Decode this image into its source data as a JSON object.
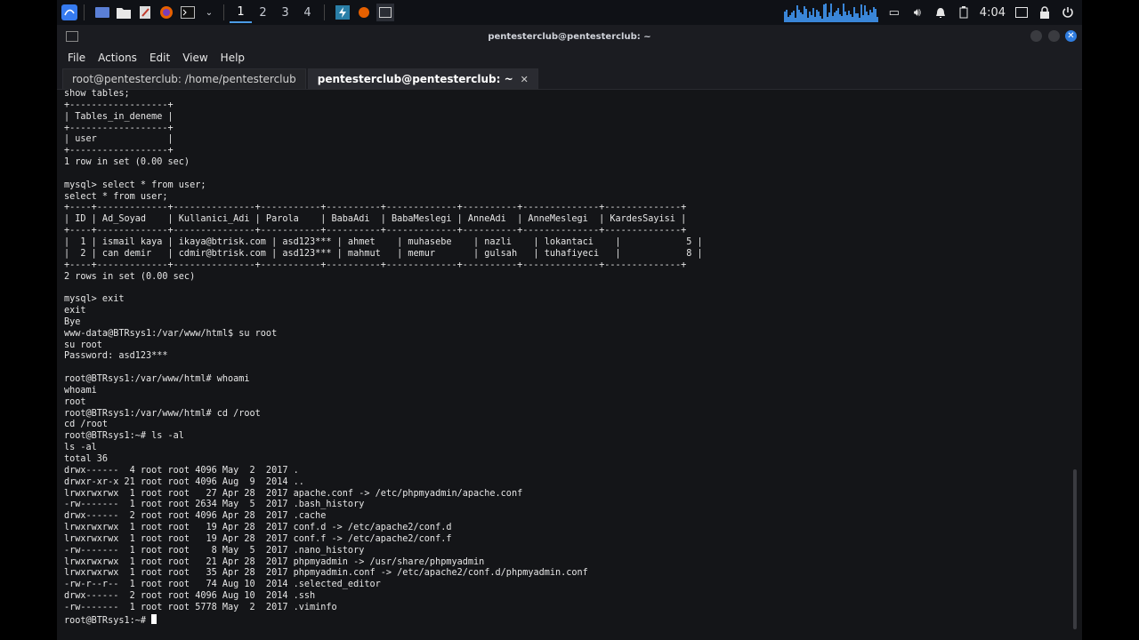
{
  "panel": {
    "workspaces": [
      "1",
      "2",
      "3",
      "4"
    ],
    "active_workspace": "1",
    "clock": "4:04",
    "graph_color": "#3a86d8"
  },
  "window": {
    "title": "pentesterclub@pentesterclub: ~",
    "menu": [
      "File",
      "Actions",
      "Edit",
      "View",
      "Help"
    ],
    "tabs": [
      {
        "label": "root@pentesterclub: /home/pentesterclub",
        "active": false
      },
      {
        "label": "pentesterclub@pentesterclub: ~",
        "active": true
      }
    ],
    "close_color": "#2f7de0"
  },
  "terminal": {
    "lines": [
      "show tables;",
      "+------------------+",
      "| Tables_in_deneme |",
      "+------------------+",
      "| user             |",
      "+------------------+",
      "1 row in set (0.00 sec)",
      "",
      "mysql> select * from user;",
      "select * from user;",
      "+----+-------------+---------------+-----------+----------+-------------+----------+--------------+--------------+",
      "| ID | Ad_Soyad    | Kullanici_Adi | Parola    | BabaAdi  | BabaMeslegi | AnneAdi  | AnneMeslegi  | KardesSayisi |",
      "+----+-------------+---------------+-----------+----------+-------------+----------+--------------+--------------+",
      "|  1 | ismail kaya | ikaya@btrisk.com | asd123*** | ahmet    | muhasebe    | nazli    | lokantaci    |            5 |",
      "|  2 | can demir   | cdmir@btrisk.com | asd123*** | mahmut   | memur       | gulsah   | tuhafiyeci   |            8 |",
      "+----+-------------+---------------+-----------+----------+-------------+----------+--------------+--------------+",
      "2 rows in set (0.00 sec)",
      "",
      "mysql> exit",
      "exit",
      "Bye",
      "www-data@BTRsys1:/var/www/html$ su root",
      "su root",
      "Password: asd123***",
      "",
      "root@BTRsys1:/var/www/html# whoami",
      "whoami",
      "root",
      "root@BTRsys1:/var/www/html# cd /root",
      "cd /root",
      "root@BTRsys1:~# ls -al",
      "ls -al",
      "total 36",
      "drwx------  4 root root 4096 May  2  2017 .",
      "drwxr-xr-x 21 root root 4096 Aug  9  2014 ..",
      "lrwxrwxrwx  1 root root   27 Apr 28  2017 apache.conf -> /etc/phpmyadmin/apache.conf",
      "-rw-------  1 root root 2634 May  5  2017 .bash_history",
      "drwx------  2 root root 4096 Apr 28  2017 .cache",
      "lrwxrwxrwx  1 root root   19 Apr 28  2017 conf.d -> /etc/apache2/conf.d",
      "lrwxrwxrwx  1 root root   19 Apr 28  2017 conf.f -> /etc/apache2/conf.f",
      "-rw-------  1 root root    8 May  5  2017 .nano_history",
      "lrwxrwxrwx  1 root root   21 Apr 28  2017 phpmyadmin -> /usr/share/phpmyadmin",
      "lrwxrwxrwx  1 root root   35 Apr 28  2017 phpmyadmin.conf -> /etc/apache2/conf.d/phpmyadmin.conf",
      "-rw-r--r--  1 root root   74 Aug 10  2014 .selected_editor",
      "drwx------  2 root root 4096 Aug 10  2014 .ssh",
      "-rw-------  1 root root 5778 May  2  2017 .viminfo"
    ],
    "prompt": "root@BTRsys1:~# "
  }
}
